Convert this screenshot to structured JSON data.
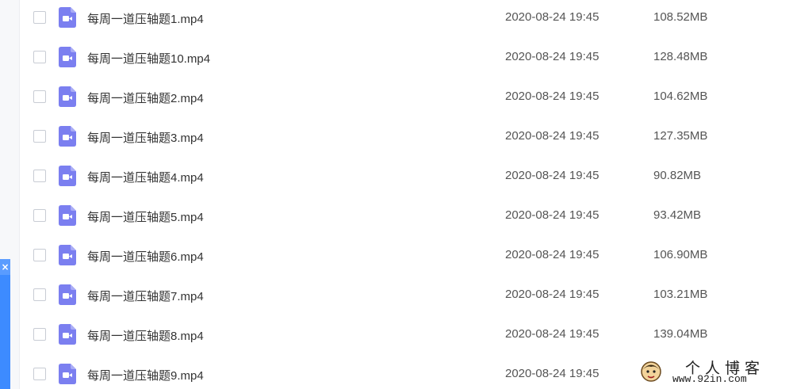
{
  "files": [
    {
      "name": "每周一道压轴题1.mp4",
      "date": "2020-08-24 19:45",
      "size": "108.52MB",
      "icon": "video-file-icon"
    },
    {
      "name": "每周一道压轴题10.mp4",
      "date": "2020-08-24 19:45",
      "size": "128.48MB",
      "icon": "video-file-icon"
    },
    {
      "name": "每周一道压轴题2.mp4",
      "date": "2020-08-24 19:45",
      "size": "104.62MB",
      "icon": "video-file-icon"
    },
    {
      "name": "每周一道压轴题3.mp4",
      "date": "2020-08-24 19:45",
      "size": "127.35MB",
      "icon": "video-file-icon"
    },
    {
      "name": "每周一道压轴题4.mp4",
      "date": "2020-08-24 19:45",
      "size": "90.82MB",
      "icon": "video-file-icon"
    },
    {
      "name": "每周一道压轴题5.mp4",
      "date": "2020-08-24 19:45",
      "size": "93.42MB",
      "icon": "video-file-icon"
    },
    {
      "name": "每周一道压轴题6.mp4",
      "date": "2020-08-24 19:45",
      "size": "106.90MB",
      "icon": "video-file-icon"
    },
    {
      "name": "每周一道压轴题7.mp4",
      "date": "2020-08-24 19:45",
      "size": "103.21MB",
      "icon": "video-file-icon"
    },
    {
      "name": "每周一道压轴题8.mp4",
      "date": "2020-08-24 19:45",
      "size": "139.04MB",
      "icon": "video-file-icon"
    },
    {
      "name": "每周一道压轴题9.mp4",
      "date": "2020-08-24 19:45",
      "size": "",
      "icon": "video-file-icon"
    }
  ],
  "side_float": {
    "close_label": "×"
  },
  "watermark": {
    "title": "个人博客",
    "url": "www.92in.com"
  },
  "colors": {
    "video_icon": "#7b7ff0",
    "video_icon_fold": "#a9acf6",
    "accent_blue": "#3d8bff",
    "text_primary": "#333333"
  }
}
